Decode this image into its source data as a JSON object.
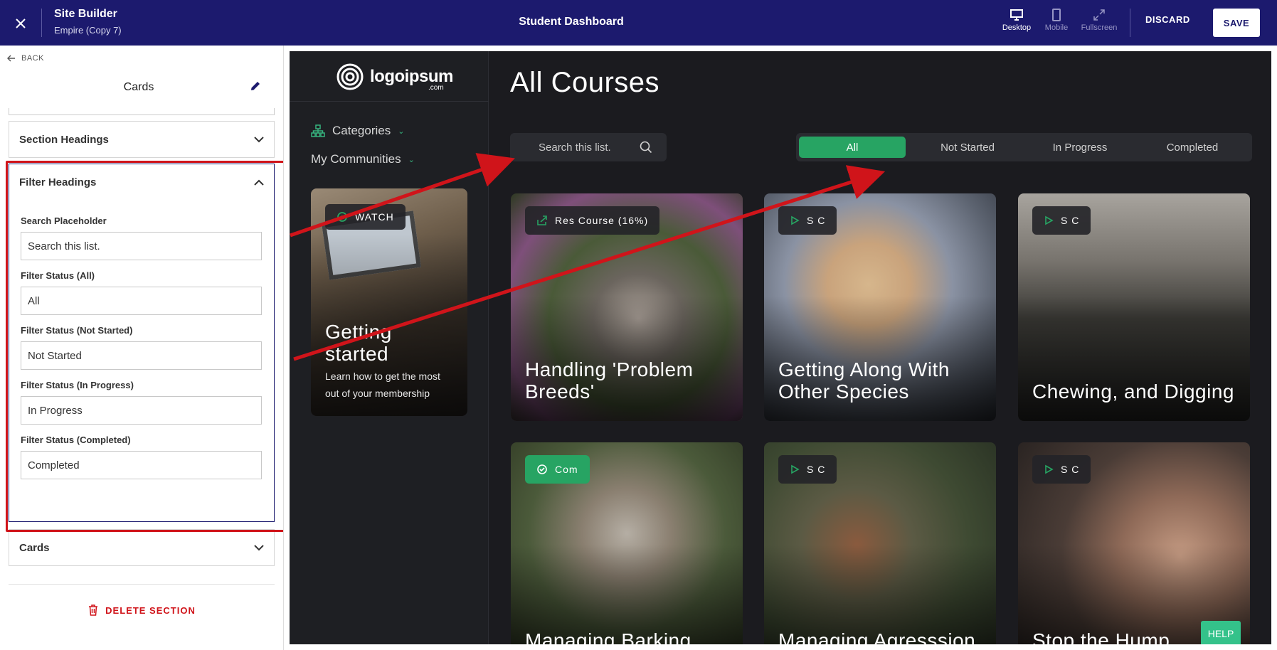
{
  "topbar": {
    "app_title": "Site Builder",
    "app_subtitle": "Empire (Copy 7)",
    "page_name": "Student Dashboard",
    "devices": [
      {
        "label": "Desktop",
        "active": true
      },
      {
        "label": "Mobile",
        "active": false
      },
      {
        "label": "Fullscreen",
        "active": false
      }
    ],
    "discard_label": "DISCARD",
    "save_label": "SAVE"
  },
  "panel": {
    "back_label": "BACK",
    "title": "Cards",
    "sections": {
      "section_headings": "Section Headings",
      "filter_headings": "Filter Headings",
      "cards": "Cards"
    },
    "fields": [
      {
        "label": "Search Placeholder",
        "value": "Search this list."
      },
      {
        "label": "Filter Status (All)",
        "value": "All"
      },
      {
        "label": "Filter Status (Not Started)",
        "value": "Not Started"
      },
      {
        "label": "Filter Status (In Progress)",
        "value": "In Progress"
      },
      {
        "label": "Filter Status (Completed)",
        "value": "Completed"
      }
    ],
    "delete_label": "DELETE SECTION"
  },
  "preview": {
    "logo_text": "logoipsum",
    "logo_suffix": ".com",
    "nav": {
      "categories": "Categories",
      "communities": "My Communities"
    },
    "side_card": {
      "badge": "WATCH",
      "title": "Getting started",
      "description": "Learn how to get the most out of your membership"
    },
    "page_title": "All Courses",
    "search_placeholder": "Search this list.",
    "filters": [
      "All",
      "Not Started",
      "In Progress",
      "Completed"
    ],
    "cards": [
      {
        "badge": "Res Course (16%)",
        "title": "Handling 'Problem Breeds'"
      },
      {
        "badge": "S C",
        "title": "Getting Along With Other Species"
      },
      {
        "badge": "S C",
        "title": "Chewing, and Digging"
      },
      {
        "badge": "Com",
        "title": "Managing Barking"
      },
      {
        "badge": "S C",
        "title": "Managing Agresssion"
      },
      {
        "badge": "S C",
        "title": "Stop the Hump"
      }
    ],
    "help_label": "HELP"
  },
  "colors": {
    "topbar": "#1c1a6e",
    "accent_green": "#27a463",
    "annotation_red": "#d0141a"
  }
}
